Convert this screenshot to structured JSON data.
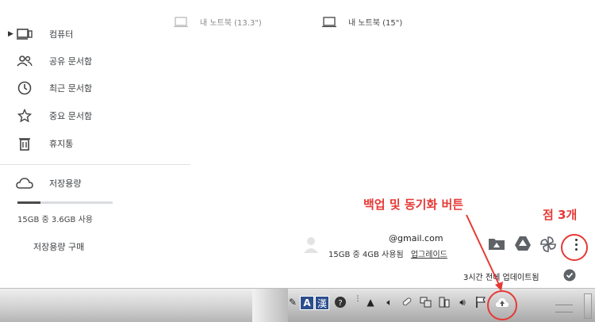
{
  "sidebar": {
    "items": [
      {
        "label": "컴퓨터",
        "icon": "computer-icon"
      },
      {
        "label": "공유 문서함",
        "icon": "people-icon"
      },
      {
        "label": "최근 문서함",
        "icon": "clock-icon"
      },
      {
        "label": "중요 문서함",
        "icon": "star-icon"
      },
      {
        "label": "휴지통",
        "icon": "trash-icon"
      }
    ],
    "storage_label": "저장용량",
    "storage_usage": "15GB 중 3.6GB 사용",
    "buy_storage": "저장용량 구매"
  },
  "devices": [
    {
      "label": "내 노트북 (13.3\")"
    },
    {
      "label": "내 노트북 (15\")"
    }
  ],
  "popup": {
    "email": "@gmail.com",
    "usage": "15GB 중 4GB 사용됨",
    "upgrade": "업그레이드",
    "status": "3시간 전에 업데이트됨"
  },
  "annotations": {
    "backup_sync": "백업 및 동기화 버튼",
    "three_dots": "점 3개",
    "accent_color": "#e53935"
  },
  "taskbar": {
    "ime_a": "A",
    "ime_han": "漢"
  }
}
